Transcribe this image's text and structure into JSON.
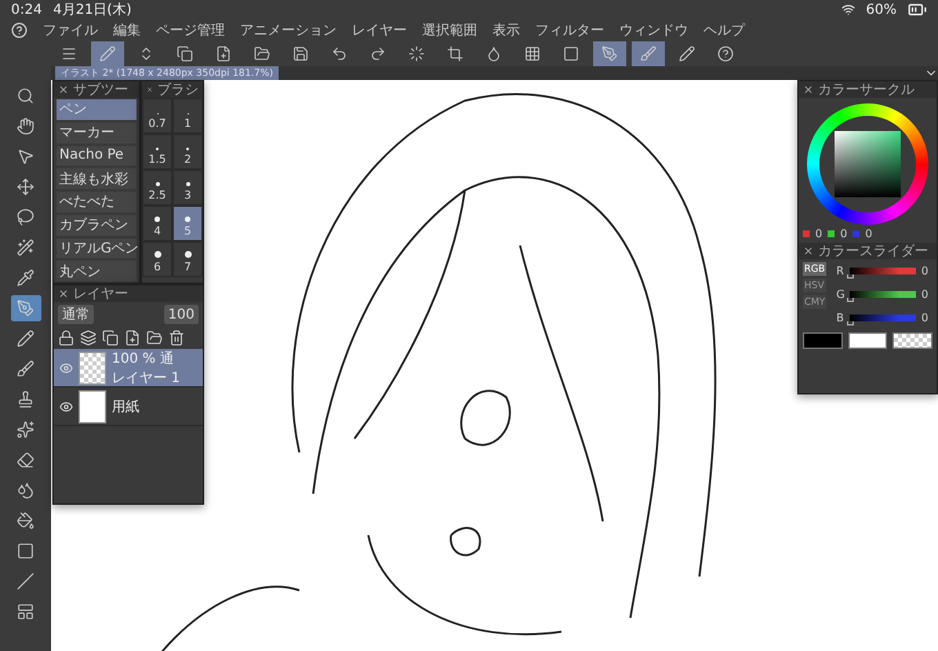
{
  "status_bar": {
    "time": "0:24",
    "date": "4月21日(木)",
    "battery": "60%"
  },
  "menu": [
    "ファイル",
    "編集",
    "ページ管理",
    "アニメーション",
    "レイヤー",
    "選択範囲",
    "表示",
    "フィルター",
    "ウィンドウ",
    "ヘルプ"
  ],
  "canvas_tab": {
    "title": "イラスト 2* (1748 x 2480px 350dpi 181.7%)"
  },
  "tools": [
    {
      "kind": "zoom",
      "selected": false
    },
    {
      "kind": "hand",
      "selected": false
    },
    {
      "kind": "pointer",
      "selected": false
    },
    {
      "kind": "move",
      "selected": false
    },
    {
      "kind": "lasso",
      "selected": false
    },
    {
      "kind": "wand",
      "selected": false
    },
    {
      "kind": "eyedropper",
      "selected": false
    },
    {
      "kind": "pen",
      "selected": true
    },
    {
      "kind": "pencil",
      "selected": false
    },
    {
      "kind": "brush",
      "selected": false
    },
    {
      "kind": "stamp",
      "selected": false
    },
    {
      "kind": "sparkle",
      "selected": false
    },
    {
      "kind": "eraser",
      "selected": false
    },
    {
      "kind": "blend",
      "selected": false
    },
    {
      "kind": "fill",
      "selected": false
    },
    {
      "kind": "gradient",
      "selected": false
    },
    {
      "kind": "line",
      "selected": false
    },
    {
      "kind": "frame",
      "selected": false
    }
  ],
  "subtool_panel": {
    "title": "サブツー",
    "items": [
      {
        "label": "ペン",
        "selected": true
      },
      {
        "label": "マーカー",
        "selected": false
      },
      {
        "label": "Nacho Pe",
        "selected": false
      },
      {
        "label": "主線も水彩",
        "selected": false
      },
      {
        "label": "べたべた",
        "selected": false
      },
      {
        "label": "カブラペン",
        "selected": false
      },
      {
        "label": "リアルGペン",
        "selected": false
      },
      {
        "label": "丸ペン",
        "selected": false
      }
    ]
  },
  "brush_size_panel": {
    "title": "ブラシ",
    "sizes": [
      {
        "label": "0.7",
        "selected": false
      },
      {
        "label": "1",
        "selected": false
      },
      {
        "label": "1.5",
        "selected": false
      },
      {
        "label": "2",
        "selected": false
      },
      {
        "label": "2.5",
        "selected": false
      },
      {
        "label": "3",
        "selected": false
      },
      {
        "label": "4",
        "selected": false
      },
      {
        "label": "5",
        "selected": true
      },
      {
        "label": "6",
        "selected": false
      },
      {
        "label": "7",
        "selected": false
      }
    ]
  },
  "layer_panel": {
    "title": "レイヤー",
    "blend_mode": "通常",
    "opacity": "100",
    "layers": [
      {
        "kind": "raster",
        "info": "100 % 通",
        "name": "レイヤー 1",
        "selected": true
      },
      {
        "kind": "paper",
        "name": "用紙",
        "selected": false
      }
    ]
  },
  "color_circle": {
    "title": "カラーサークル",
    "values": [
      "0",
      "0",
      "0"
    ]
  },
  "color_slider": {
    "title": "カラースライダー",
    "modes": [
      {
        "label": "RGB",
        "selected": true
      },
      {
        "label": "HSV",
        "selected": false
      },
      {
        "label": "CMY",
        "selected": false
      }
    ],
    "channels": [
      {
        "label": "R",
        "value": "0",
        "level": 0,
        "color": "#e03a3a"
      },
      {
        "label": "G",
        "value": "0",
        "level": 0,
        "color": "#4cc84c"
      },
      {
        "label": "B",
        "value": "0",
        "level": 0,
        "color": "#2a3ae0"
      }
    ]
  }
}
